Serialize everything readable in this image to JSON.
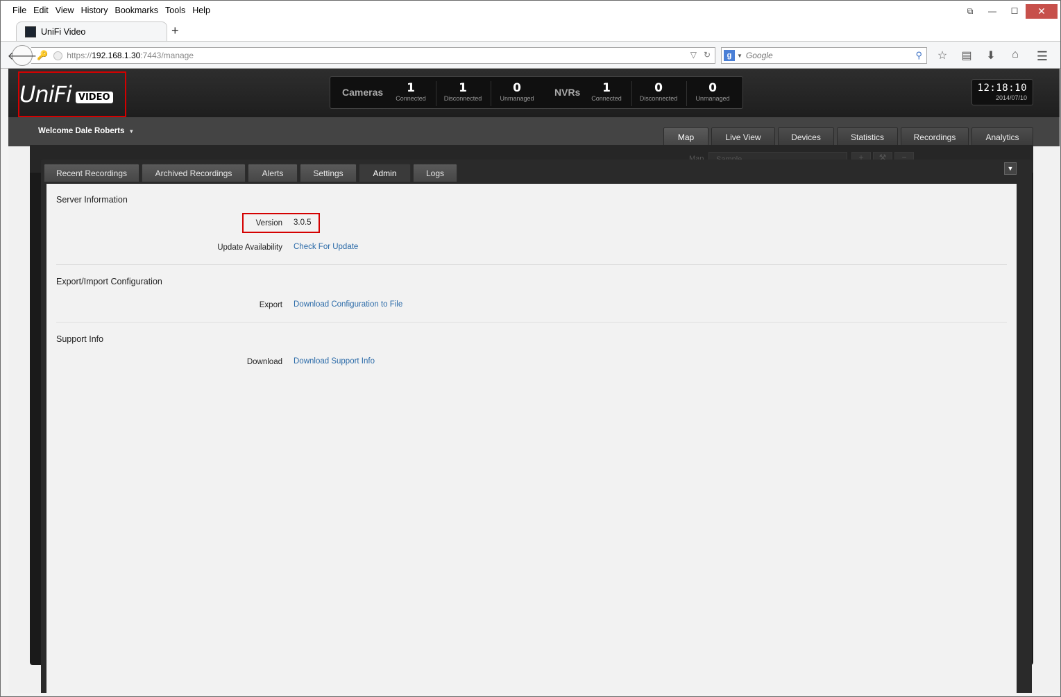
{
  "browser": {
    "menu": [
      "File",
      "Edit",
      "View",
      "History",
      "Bookmarks",
      "Tools",
      "Help"
    ],
    "tab_title": "UniFi Video",
    "new_tab": "+",
    "url_prefix": "https://",
    "url_host": "192.168.1.30",
    "url_rest": ":7443/manage",
    "search_placeholder": "Google"
  },
  "header": {
    "logo_text": "UniFi",
    "logo_badge": "VIDEO",
    "cameras_label": "Cameras",
    "nvrs_label": "NVRs",
    "cameras": [
      {
        "num": "1",
        "sub": "Connected"
      },
      {
        "num": "1",
        "sub": "Disconnected"
      },
      {
        "num": "0",
        "sub": "Unmanaged"
      }
    ],
    "nvrs": [
      {
        "num": "1",
        "sub": "Connected"
      },
      {
        "num": "0",
        "sub": "Disconnected"
      },
      {
        "num": "0",
        "sub": "Unmanaged"
      }
    ],
    "time": "12:18:10",
    "date": "2014/07/10"
  },
  "subheader": {
    "welcome": "Welcome Dale Roberts",
    "tabs": [
      "Map",
      "Live View",
      "Devices",
      "Statistics",
      "Recordings",
      "Analytics"
    ]
  },
  "map_bar": {
    "label": "Map",
    "select_value": "Sample"
  },
  "admin": {
    "tabs": [
      "Recent Recordings",
      "Archived Recordings",
      "Alerts",
      "Settings",
      "Admin",
      "Logs"
    ],
    "server_info_title": "Server Information",
    "version_label": "Version",
    "version_value": "3.0.5",
    "update_label": "Update Availability",
    "update_link": "Check For Update",
    "export_title": "Export/Import Configuration",
    "export_label": "Export",
    "export_link": "Download Configuration to File",
    "support_title": "Support Info",
    "download_label": "Download",
    "download_link": "Download Support Info"
  }
}
